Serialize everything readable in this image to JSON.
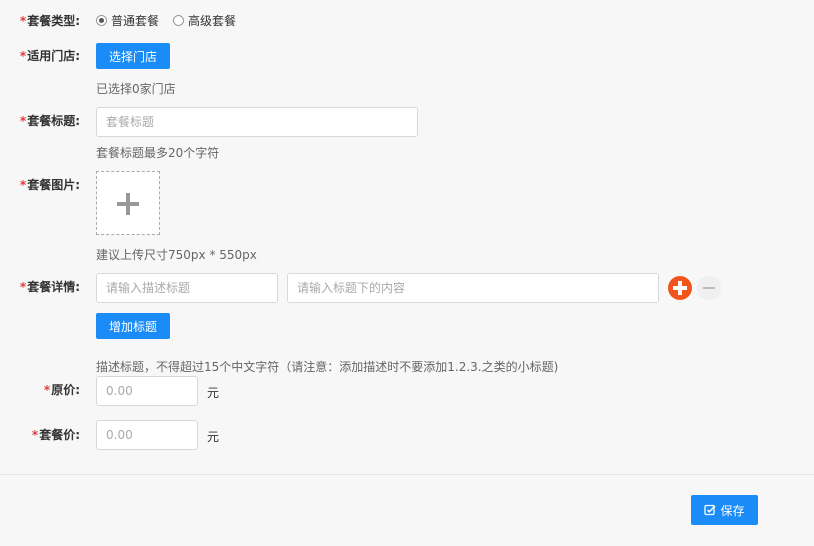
{
  "form": {
    "package_type": {
      "label": "套餐类型:",
      "options": [
        "普通套餐",
        "高级套餐"
      ],
      "selected": "普通套餐"
    },
    "stores": {
      "label": "适用门店:",
      "button": "选择门店",
      "hint": "已选择0家门店"
    },
    "title": {
      "label": "套餐标题:",
      "placeholder": "套餐标题",
      "hint": "套餐标题最多20个字符"
    },
    "image": {
      "label": "套餐图片:",
      "hint": "建议上传尺寸750px * 550px"
    },
    "details": {
      "label": "套餐详情:",
      "desc_placeholder": "请输入描述标题",
      "content_placeholder": "请输入标题下的内容",
      "add_button": "增加标题",
      "hint": "描述标题，不得超过15个中文字符（请注意：添加描述时不要添加1.2.3.之类的小标题)"
    },
    "original_price": {
      "label": "原价:",
      "placeholder": "0.00",
      "unit": "元"
    },
    "package_price": {
      "label": "套餐价:",
      "placeholder": "0.00",
      "unit": "元"
    }
  },
  "footer": {
    "save_button": "保存",
    "save_icon": "edit-check-icon"
  },
  "colors": {
    "primary": "#1b8cf7",
    "required": "#e4393c",
    "add": "#f2541b"
  }
}
